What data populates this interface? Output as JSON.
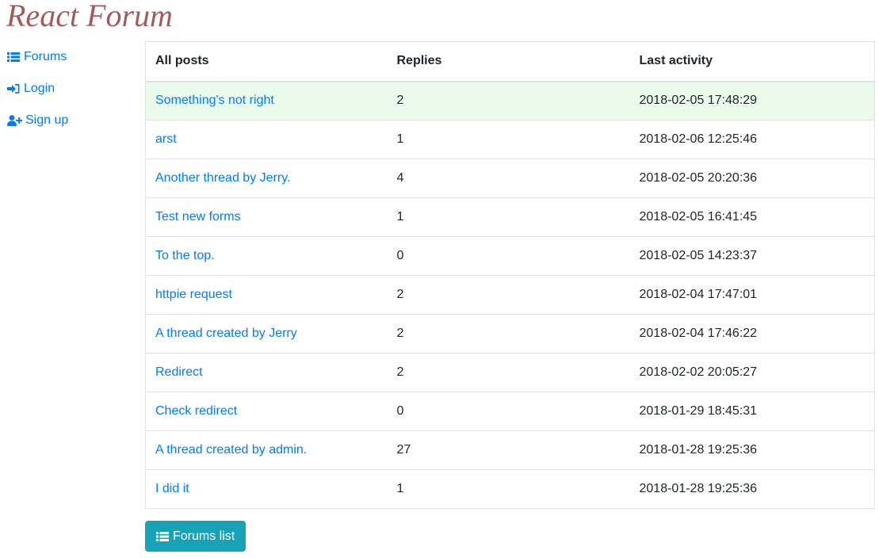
{
  "site": {
    "title": "React Forum"
  },
  "sidebar": {
    "items": [
      {
        "label": "Forums",
        "icon": "list-icon"
      },
      {
        "label": "Login",
        "icon": "sign-in-icon"
      },
      {
        "label": "Sign up",
        "icon": "user-plus-icon"
      }
    ]
  },
  "table": {
    "headers": [
      "All posts",
      "Replies",
      "Last activity"
    ],
    "rows": [
      {
        "title": "Something's not right",
        "replies": "2",
        "last_activity": "2018-02-05 17:48:29",
        "highlighted": true
      },
      {
        "title": "arst",
        "replies": "1",
        "last_activity": "2018-02-06 12:25:46"
      },
      {
        "title": "Another thread by Jerry.",
        "replies": "4",
        "last_activity": "2018-02-05 20:20:36"
      },
      {
        "title": "Test new forms",
        "replies": "1",
        "last_activity": "2018-02-05 16:41:45"
      },
      {
        "title": "To the top.",
        "replies": "0",
        "last_activity": "2018-02-05 14:23:37"
      },
      {
        "title": "httpie request",
        "replies": "2",
        "last_activity": "2018-02-04 17:47:01"
      },
      {
        "title": "A thread created by Jerry",
        "replies": "2",
        "last_activity": "2018-02-04 17:46:22"
      },
      {
        "title": "Redirect",
        "replies": "2",
        "last_activity": "2018-02-02 20:05:27"
      },
      {
        "title": "Check redirect",
        "replies": "0",
        "last_activity": "2018-01-29 18:45:31"
      },
      {
        "title": "A thread created by admin.",
        "replies": "27",
        "last_activity": "2018-01-28 19:25:36"
      },
      {
        "title": "I did it",
        "replies": "1",
        "last_activity": "2018-01-28 19:25:36"
      }
    ]
  },
  "footer": {
    "forums_list_label": "Forums list",
    "icon": "list-icon"
  },
  "colors": {
    "title": "#a45a5a",
    "link": "#007bff",
    "button": "#17a2b8",
    "highlight_row": "#ebfbeb"
  }
}
